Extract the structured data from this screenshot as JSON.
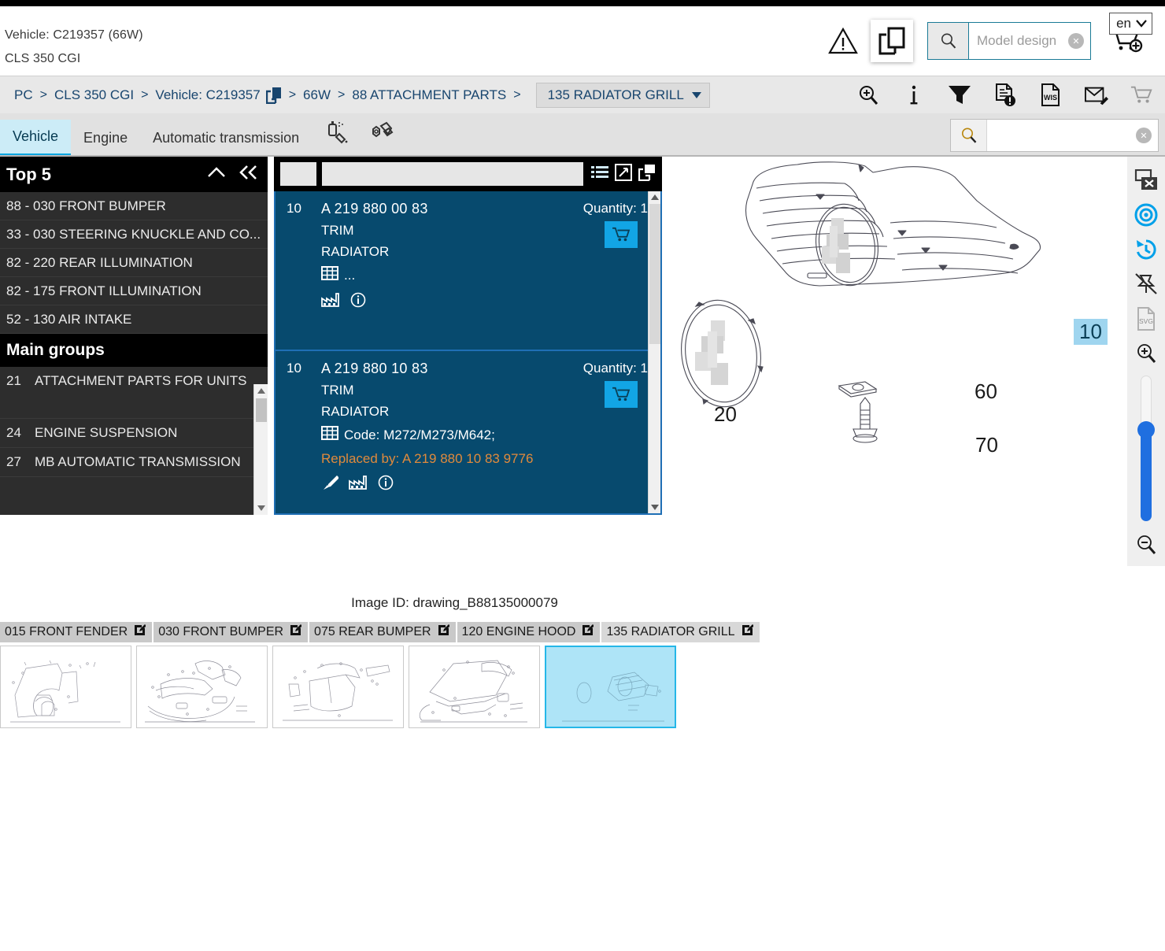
{
  "header": {
    "vehicle_line1": "Vehicle: C219357 (66W)",
    "vehicle_line2": "CLS 350 CGI",
    "warning_icon": "warning-triangle-icon",
    "copy_icon": "copy-documents-icon",
    "model_search_placeholder": "Model design",
    "model_search_value": "",
    "cart_icon": "cart-add-icon",
    "language": "en"
  },
  "breadcrumb": {
    "items": [
      {
        "label": "PC"
      },
      {
        "label": "CLS 350 CGI"
      },
      {
        "label": "Vehicle: C219357"
      },
      {
        "label": "66W"
      },
      {
        "label": "88 ATTACHMENT PARTS"
      }
    ],
    "separator": ">",
    "current": "135 RADIATOR GRILL",
    "tools": [
      "magnifier-plus-icon",
      "info-icon",
      "filter-funnel-icon",
      "document-alert-icon",
      "wis-document-icon",
      "mail-edit-icon",
      "shopping-cart-icon"
    ]
  },
  "tabs": {
    "items": [
      {
        "label": "Vehicle",
        "active": true
      },
      {
        "label": "Engine",
        "active": false
      },
      {
        "label": "Automatic transmission",
        "active": false
      }
    ],
    "icons": [
      "paint-spray-icon",
      "bolt-fastener-icon"
    ],
    "search_value": "",
    "search_placeholder": ""
  },
  "sidebar": {
    "top5_title": "Top 5",
    "collapse_icon": "chevron-up-icon",
    "collapse_all_icon": "double-chevron-left-icon",
    "top5_items": [
      {
        "label": "88 - 030 FRONT BUMPER"
      },
      {
        "label": "33 - 030 STEERING KNUCKLE AND CO..."
      },
      {
        "label": "82 - 220 REAR ILLUMINATION"
      },
      {
        "label": "82 - 175 FRONT ILLUMINATION"
      },
      {
        "label": "52 - 130 AIR INTAKE"
      }
    ],
    "main_groups_title": "Main groups",
    "main_groups": [
      {
        "num": "21",
        "label": "ATTACHMENT PARTS FOR UNITS"
      },
      {
        "num": "24",
        "label": "ENGINE SUSPENSION"
      },
      {
        "num": "27",
        "label": "MB AUTOMATIC TRANSMISSION"
      }
    ]
  },
  "parts_panel": {
    "filter_value": "",
    "header_icons": [
      "list-view-icon",
      "expand-icon",
      "popout-icon"
    ],
    "rows": [
      {
        "position": "10",
        "part_number": "A 219 880 00 83",
        "name_line1": "TRIM",
        "name_line2": "RADIATOR",
        "code_icon": "grid-table-icon",
        "code_text": "...",
        "replaced_by": "",
        "quantity_label": "Quantity: 1",
        "cart_icon": "add-to-cart-icon",
        "icons": [
          "factory-icon",
          "info-circle-icon"
        ]
      },
      {
        "position": "10",
        "part_number": "A 219 880 10 83",
        "name_line1": "TRIM",
        "name_line2": "RADIATOR",
        "code_icon": "grid-table-icon",
        "code_text": "Code: M272/M273/M642;",
        "replaced_by": "Replaced by: A 219 880 10 83 9776",
        "quantity_label": "Quantity: 1",
        "cart_icon": "add-to-cart-icon",
        "icons": [
          "paint-brush-icon",
          "factory-icon",
          "info-circle-icon"
        ]
      }
    ]
  },
  "diagram": {
    "image_id": "Image ID: drawing_B88135000079",
    "callouts": [
      {
        "label": "10",
        "highlight": true
      },
      {
        "label": "20",
        "highlight": false
      },
      {
        "label": "60",
        "highlight": false
      },
      {
        "label": "70",
        "highlight": false
      }
    ],
    "vertical_tools": [
      "close-window-icon",
      "target-focus-icon",
      "history-undo-icon",
      "unpin-icon",
      "svg-export-icon",
      "zoom-in-icon",
      "zoom-slider",
      "zoom-out-icon"
    ]
  },
  "thumbnails": {
    "tabs": [
      {
        "label": "015 FRONT FENDER",
        "edit_icon": "edit-icon",
        "selected": false
      },
      {
        "label": "030 FRONT BUMPER",
        "edit_icon": "edit-icon",
        "selected": false
      },
      {
        "label": "075 REAR BUMPER",
        "edit_icon": "edit-icon",
        "selected": false
      },
      {
        "label": "120 ENGINE HOOD",
        "edit_icon": "edit-icon",
        "selected": false
      },
      {
        "label": "135 RADIATOR GRILL",
        "edit_icon": "edit-icon",
        "selected": true
      }
    ]
  },
  "colors": {
    "accent_cyan": "#00a5e0",
    "panel_blue": "#074a6e",
    "panel_border": "#1f6fb5",
    "breadcrumb_text": "#18456e",
    "replaced_orange": "#e08a3c",
    "highlight_blue": "#9fd5ef",
    "sidebar_dark": "#2d2d2d"
  }
}
